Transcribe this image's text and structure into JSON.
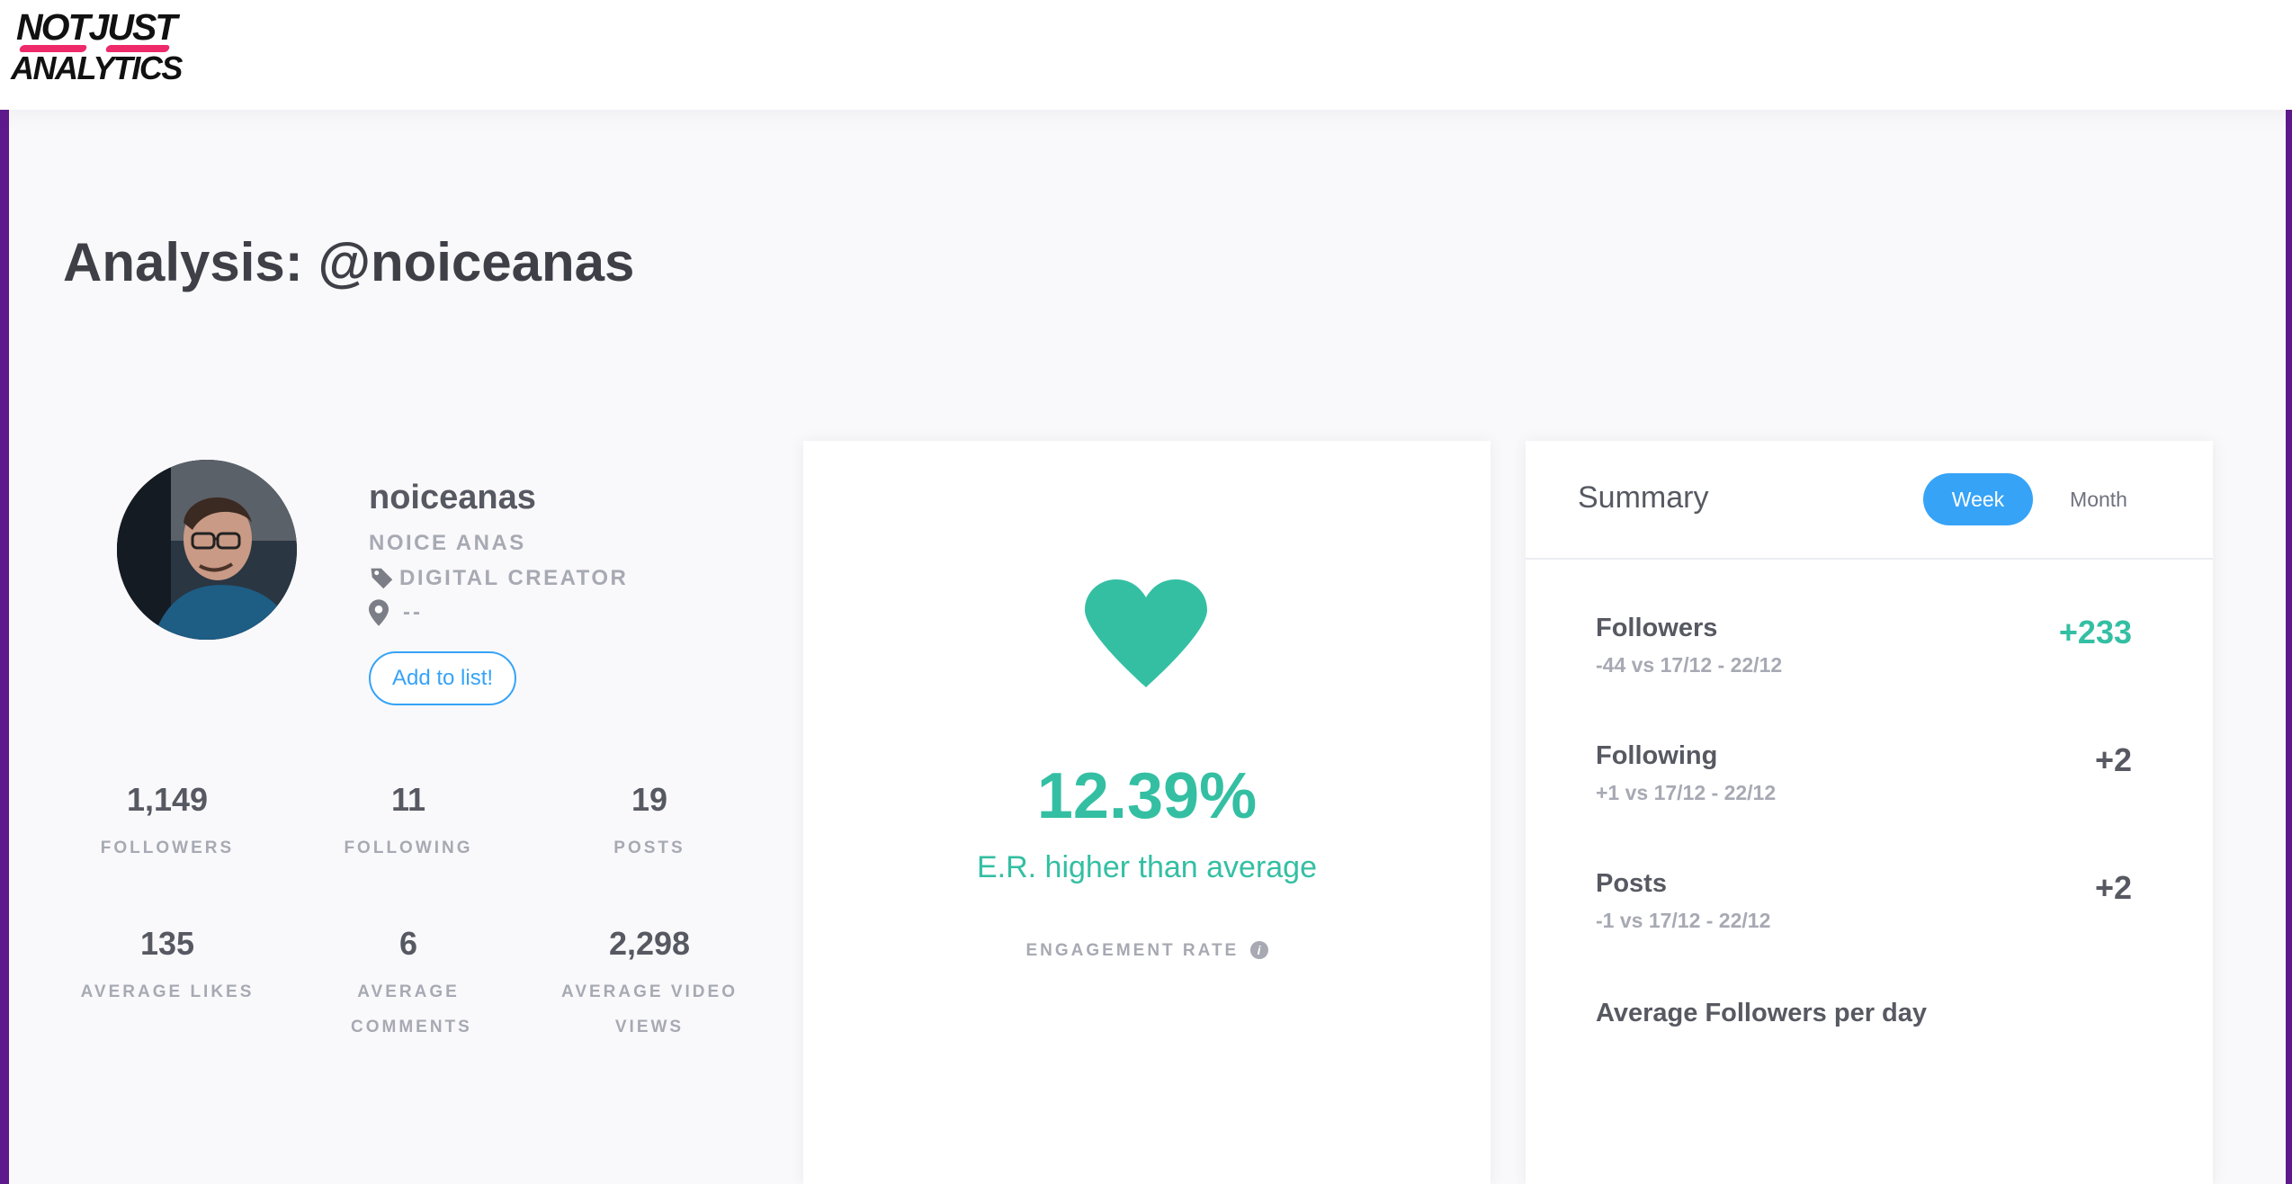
{
  "app": {
    "logo_line1": "NOTJUST",
    "logo_line2": "ANALYTICS"
  },
  "page": {
    "title": "Analysis: @noiceanas"
  },
  "profile": {
    "username": "noiceanas",
    "full_name": "NOICE ANAS",
    "category": "DIGITAL CREATOR",
    "location": "--",
    "add_to_list_label": "Add to list!",
    "stats": [
      {
        "value": "1,149",
        "label": "FOLLOWERS"
      },
      {
        "value": "11",
        "label": "FOLLOWING"
      },
      {
        "value": "19",
        "label": "POSTS"
      },
      {
        "value": "135",
        "label": "AVERAGE LIKES"
      },
      {
        "value": "6",
        "label": "AVERAGE COMMENTS"
      },
      {
        "value": "2,298",
        "label": "AVERAGE VIDEO VIEWS"
      }
    ]
  },
  "engagement": {
    "value": "12.39%",
    "description": "E.R. higher than average",
    "label": "ENGAGEMENT RATE",
    "icon": "heart-icon",
    "color": "#34bfa3"
  },
  "summary": {
    "title": "Summary",
    "tabs": [
      {
        "label": "Week",
        "active": true
      },
      {
        "label": "Month",
        "active": false
      }
    ],
    "rows": [
      {
        "label": "Followers",
        "sub": "-44 vs 17/12 - 22/12",
        "value": "+233"
      },
      {
        "label": "Following",
        "sub": "+1 vs 17/12 - 22/12",
        "value": "+2"
      },
      {
        "label": "Posts",
        "sub": "-1 vs 17/12 - 22/12",
        "value": "+2"
      }
    ],
    "avg_followers_label": "Average Followers per day"
  },
  "colors": {
    "accent": "#36a3f7",
    "positive": "#34bfa3",
    "sidebar": "#5e1a8c",
    "logo_stripe": "#ee2a6a"
  }
}
